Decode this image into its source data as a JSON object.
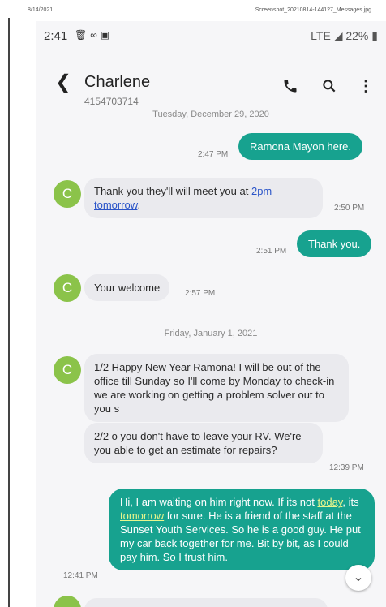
{
  "print_header": {
    "date": "8/14/2021",
    "filename": "Screenshot_20210814-144127_Messages.jpg"
  },
  "status_bar": {
    "time": "2:41",
    "icons": [
      "trash-icon",
      "voicemail-icon",
      "image-icon"
    ],
    "signal": "LTE",
    "battery": "22%"
  },
  "header": {
    "contact_name": "Charlene",
    "contact_number": "4154703714",
    "icons": [
      "back-icon",
      "phone-icon",
      "search-icon",
      "more-icon"
    ]
  },
  "messages": [
    {
      "date": "Tuesday, December 29, 2020"
    },
    {
      "dir": "out",
      "text": "Ramona Mayon here.",
      "time": "2:47 PM"
    },
    {
      "dir": "in",
      "avatar": "C",
      "text_before": "Thank you they'll will meet you at ",
      "link": "2pm tomorrow",
      "text_after": ".",
      "time": "2:50 PM"
    },
    {
      "dir": "out",
      "text": "Thank you.",
      "time": "2:51 PM"
    },
    {
      "dir": "in",
      "avatar": "C",
      "text": "Your welcome",
      "time": "2:57 PM"
    },
    {
      "date": "Friday, January 1, 2021"
    },
    {
      "dir": "in",
      "avatar": "C",
      "text": "1/2 Happy New Year Ramona! I will be out of the office till Sunday so I'll come by Monday to check-in we are working on getting a problem solver out to you s"
    },
    {
      "dir": "in",
      "text": "2/2 o you don't have to leave your RV. We're you able to get an estimate for repairs?",
      "time": "12:39 PM"
    },
    {
      "dir": "out",
      "text_1": "Hi, I am waiting on him right now.  If its not ",
      "link_1": "today",
      "text_2": ", its ",
      "link_2": "tomorrow",
      "text_3": " for sure.  He is a friend of the staff at the Sunset  Youth Services.  So he is a good guy.  He put my car back together for me.  Bit by bit, as I could pay him.  So I trust him.",
      "time": "12:41 PM"
    }
  ],
  "colors": {
    "outgoing": "#17a28f",
    "incoming": "#eaeaee",
    "avatar": "#8bc34a",
    "link": "#2a54c8"
  }
}
